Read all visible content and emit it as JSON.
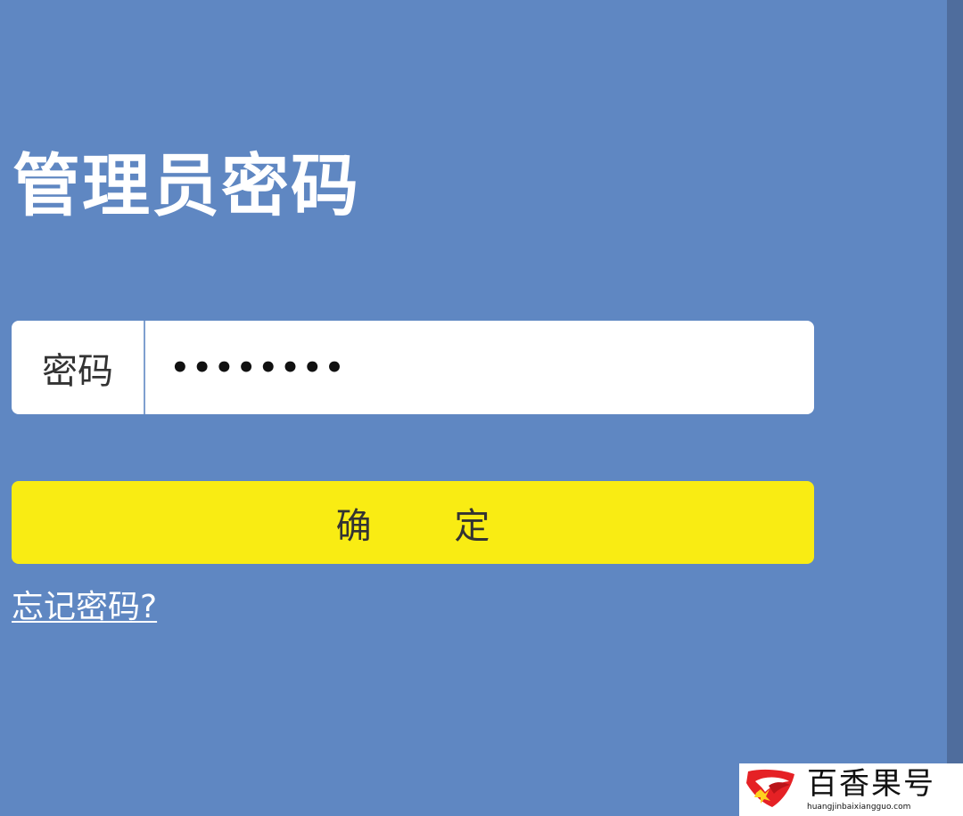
{
  "page": {
    "title": "管理员密码"
  },
  "password": {
    "label": "密码",
    "value": "••••••••"
  },
  "confirm_button": {
    "label": "确 定"
  },
  "forgot_link": {
    "label": "忘记密码?"
  },
  "watermark": {
    "name": "百香果号",
    "url": "huangjinbaixiangguo.com"
  },
  "colors": {
    "background": "#5f87c2",
    "right_edge": "#4f6d9d",
    "button": "#f9ec13",
    "input_background": "#ffffff",
    "title": "#ffffff",
    "watermark_red": "#e52125"
  },
  "icons": {
    "watermark_logo": "red-stylized-logo-icon"
  }
}
